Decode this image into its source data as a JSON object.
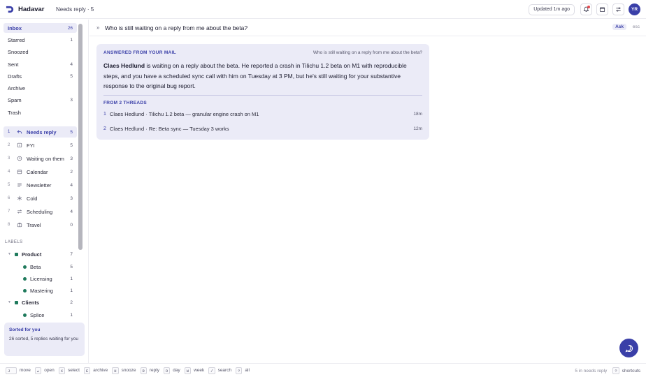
{
  "app": {
    "name": "Hadavar",
    "crumb": "Needs reply · 5"
  },
  "header": {
    "updated": "Updated 1m ago",
    "avatar_initials": "YR"
  },
  "sidebar": {
    "mailboxes": [
      {
        "label": "Inbox",
        "count": "26",
        "active": true
      },
      {
        "label": "Starred",
        "count": "1"
      },
      {
        "label": "Snoozed",
        "count": ""
      },
      {
        "label": "Sent",
        "count": "4"
      },
      {
        "label": "Drafts",
        "count": "5"
      },
      {
        "label": "Archive",
        "count": ""
      },
      {
        "label": "Spam",
        "count": "3"
      },
      {
        "label": "Trash",
        "count": ""
      }
    ],
    "categories": [
      {
        "num": "1",
        "icon": "reply-icon",
        "label": "Needs reply",
        "count": "5",
        "active": true
      },
      {
        "num": "2",
        "icon": "info-icon",
        "label": "FYI",
        "count": "5"
      },
      {
        "num": "3",
        "icon": "clock-icon",
        "label": "Waiting on them",
        "count": "3"
      },
      {
        "num": "4",
        "icon": "calendar-icon",
        "label": "Calendar",
        "count": "2"
      },
      {
        "num": "5",
        "icon": "newsletter-icon",
        "label": "Newsletter",
        "count": "4"
      },
      {
        "num": "6",
        "icon": "snowflake-icon",
        "label": "Cold",
        "count": "3"
      },
      {
        "num": "7",
        "icon": "swap-icon",
        "label": "Scheduling",
        "count": "4"
      },
      {
        "num": "8",
        "icon": "suitcase-icon",
        "label": "Travel",
        "count": "0"
      }
    ],
    "labels_heading": "LABELS",
    "labels": [
      {
        "label": "Product",
        "count": "7",
        "parent": true
      },
      {
        "label": "Beta",
        "count": "5"
      },
      {
        "label": "Licensing",
        "count": "1"
      },
      {
        "label": "Mastering",
        "count": "1"
      },
      {
        "label": "Clients",
        "count": "2",
        "parent": true
      },
      {
        "label": "Splice",
        "count": "1"
      }
    ],
    "sorted": {
      "title": "Sorted for you",
      "text": "26 sorted, 5 replies waiting for you"
    }
  },
  "ask": {
    "query": "Who is still waiting on a reply from me about the beta?",
    "button": "Ask",
    "esc": "esc"
  },
  "answer": {
    "heading": "ANSWERED FROM YOUR MAIL",
    "question": "Who is still waiting on a reply from me about the beta?",
    "name": "Claes Hedlund",
    "body": " is waiting on a reply about the beta. He reported a crash in Tilichu 1.2 beta on M1 with reproducible steps, and you have a scheduled sync call with him on Tuesday at 3 PM, but he's still waiting for your substantive response to the original bug report.",
    "from_heading": "FROM 2 THREADS",
    "threads": [
      {
        "num": "1",
        "text": "Claes Hedlund · Tilichu 1.2 beta — granular engine crash on M1",
        "time": "18m"
      },
      {
        "num": "2",
        "text": "Claes Hedlund · Re: Beta sync — Tuesday 3 works",
        "time": "12m"
      }
    ]
  },
  "footer": {
    "shortcuts": [
      {
        "key": "J",
        "label": "move"
      },
      {
        "key": "↵",
        "label": "open"
      },
      {
        "key": "X",
        "label": "select"
      },
      {
        "key": "E",
        "label": "archive"
      },
      {
        "key": "H",
        "label": "snooze"
      },
      {
        "key": "R",
        "label": "reply"
      },
      {
        "key": "D",
        "label": "day"
      },
      {
        "key": "W",
        "label": "week"
      },
      {
        "key": "/",
        "label": "search"
      },
      {
        "key": "?",
        "label": "all"
      }
    ],
    "status": "5 in needs reply",
    "help_key": "?",
    "help_label": "shortcuts"
  },
  "colors": {
    "accent": "#3a3fa8",
    "accent_bg": "#ebebf7",
    "label_green": "#1f7a5c",
    "notify_red": "#e5484d"
  }
}
